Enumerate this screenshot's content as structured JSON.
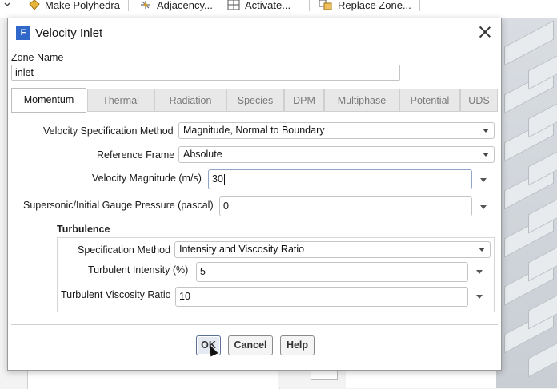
{
  "toolbar": {
    "items": [
      {
        "label": "Make Polyhedra",
        "icon": "polyhedra-icon"
      },
      {
        "label": "Adjacency...",
        "icon": "adjacency-icon"
      },
      {
        "label": "Activate...",
        "icon": "grid-icon"
      },
      {
        "label": "Replace Zone...",
        "icon": "replace-zone-icon"
      }
    ]
  },
  "dialog": {
    "icon_letter": "F",
    "title": "Velocity Inlet",
    "zone_name_label": "Zone Name",
    "zone_name_value": "inlet",
    "tabs": [
      "Momentum",
      "Thermal",
      "Radiation",
      "Species",
      "DPM",
      "Multiphase",
      "Potential",
      "UDS"
    ],
    "active_tab": "Momentum",
    "momentum": {
      "velocity_spec_label": "Velocity Specification Method",
      "velocity_spec_value": "Magnitude, Normal to Boundary",
      "reference_frame_label": "Reference Frame",
      "reference_frame_value": "Absolute",
      "velocity_magnitude_label": "Velocity Magnitude (m/s)",
      "velocity_magnitude_value": "30",
      "gauge_pressure_label": "Supersonic/Initial Gauge Pressure (pascal)",
      "gauge_pressure_value": "0",
      "turbulence": {
        "title": "Turbulence",
        "spec_method_label": "Specification Method",
        "spec_method_value": "Intensity and Viscosity Ratio",
        "intensity_label": "Turbulent Intensity (%)",
        "intensity_value": "5",
        "viscosity_ratio_label": "Turbulent Viscosity Ratio",
        "viscosity_ratio_value": "10"
      }
    },
    "buttons": {
      "ok": "OK",
      "cancel": "Cancel",
      "help": "Help"
    }
  }
}
